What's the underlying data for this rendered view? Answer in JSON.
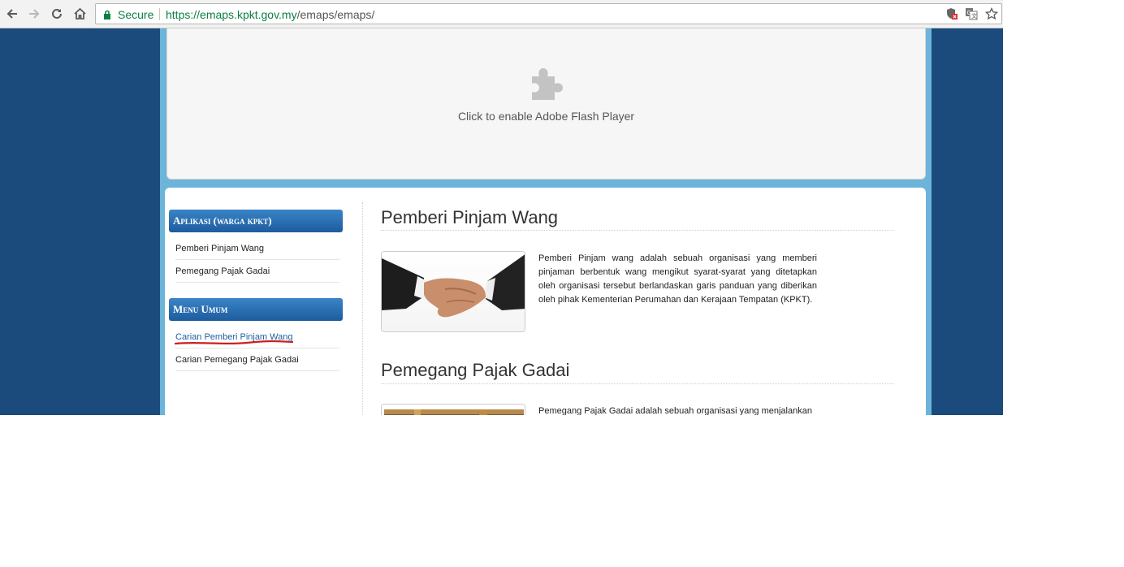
{
  "browser": {
    "secure_label": "Secure",
    "url_scheme": "https://",
    "url_host": "emaps.kpkt.gov.my",
    "url_path": "/emaps/emaps/",
    "icons": [
      "back-icon",
      "forward-icon",
      "reload-icon",
      "home-icon",
      "lock-icon",
      "shield-icon",
      "translate-icon",
      "star-icon"
    ]
  },
  "flash": {
    "message": "Click to enable Adobe Flash Player",
    "icon": "puzzle-icon"
  },
  "sidebar": {
    "aplikasi_title": "Aplikasi (warga kpkt)",
    "aplikasi_items": [
      "Pemberi Pinjam Wang",
      "Pemegang Pajak Gadai"
    ],
    "menu_title": "Menu Umum",
    "menu_items": [
      "Carian Pemberi Pinjam Wang",
      "Carian Pemegang Pajak Gadai"
    ]
  },
  "main": {
    "section1_title": "Pemberi Pinjam Wang",
    "section1_text": "Pemberi Pinjam wang adalah sebuah organisasi yang memberi pinjaman berbentuk wang mengikut syarat-syarat yang ditetapkan oleh organisasi tersebut berlandaskan garis panduan yang diberikan oleh pihak Kementerian Perumahan dan Kerajaan Tempatan (KPKT).",
    "section2_title": "Pemegang Pajak Gadai",
    "section2_text": "Pemegang Pajak Gadai adalah sebuah organisasi yang menjalankan"
  },
  "colors": {
    "page_bg": "#1b4a7c",
    "frame": "#6cb4d9",
    "sidebar_header": "#1e5c9d",
    "link": "#1f5fa0",
    "annotation_underline": "#cc1f1f"
  }
}
